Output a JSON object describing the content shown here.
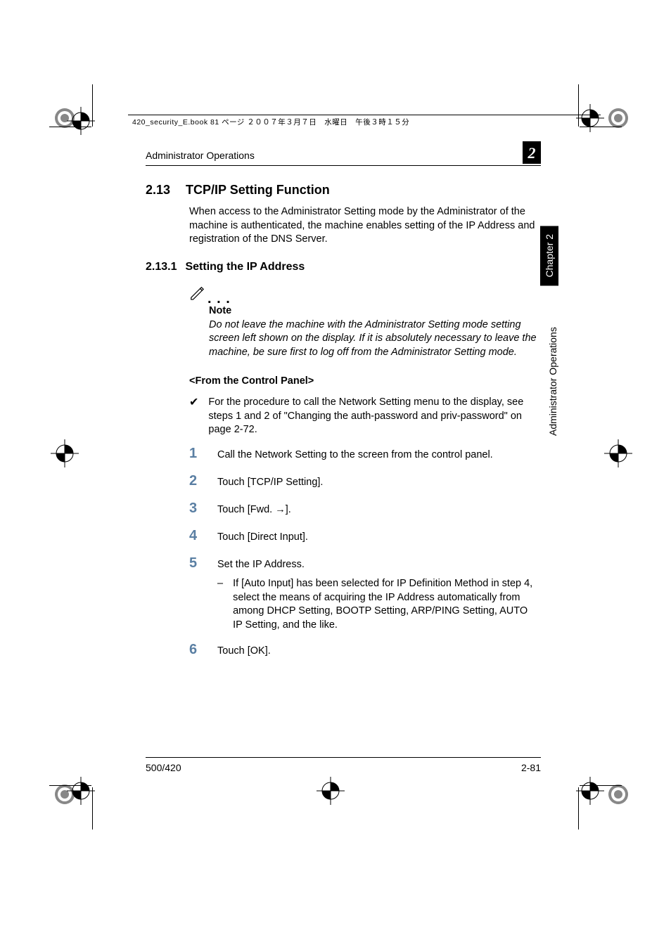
{
  "file_header": "420_security_E.book  81 ページ  ２００７年３月７日　水曜日　午後３時１５分",
  "running_header": {
    "left": "Administrator Operations",
    "chapter_badge": "2"
  },
  "side_tabs": {
    "black": "Chapter 2",
    "plain": "Administrator Operations"
  },
  "section": {
    "number": "2.13",
    "title": "TCP/IP Setting Function",
    "intro": "When access to the Administrator Setting mode by the Administrator of the machine is authenticated, the machine enables setting of the IP Address and registration of the DNS Server."
  },
  "subsection": {
    "number": "2.13.1",
    "title": "Setting the IP Address"
  },
  "note": {
    "label": "Note",
    "text": "Do not leave the machine with the Administrator Setting mode setting screen left shown on the display. If it is absolutely necessary to leave the machine, be sure first to log off from the Administrator Setting mode."
  },
  "panel_heading": "<From the Control Panel>",
  "precond": "For the procedure to call the Network Setting menu to the display, see steps 1 and 2 of \"Changing the auth-password and priv-password\" on page 2-72.",
  "steps": [
    {
      "n": "1",
      "t": "Call the Network Setting to the screen from the control panel."
    },
    {
      "n": "2",
      "t": "Touch [TCP/IP Setting]."
    },
    {
      "n": "3",
      "t": "Touch [Fwd. →]."
    },
    {
      "n": "4",
      "t": "Touch [Direct Input]."
    },
    {
      "n": "5",
      "t": "Set the IP Address.",
      "sub": "If [Auto Input] has been selected for IP Definition Method in step 4, select the means of acquiring the IP Address automatically from among DHCP Setting, BOOTP Setting, ARP/PING Setting, AUTO IP Setting, and the like."
    },
    {
      "n": "6",
      "t": "Touch [OK]."
    }
  ],
  "footer": {
    "left": "500/420",
    "right": "2-81"
  }
}
